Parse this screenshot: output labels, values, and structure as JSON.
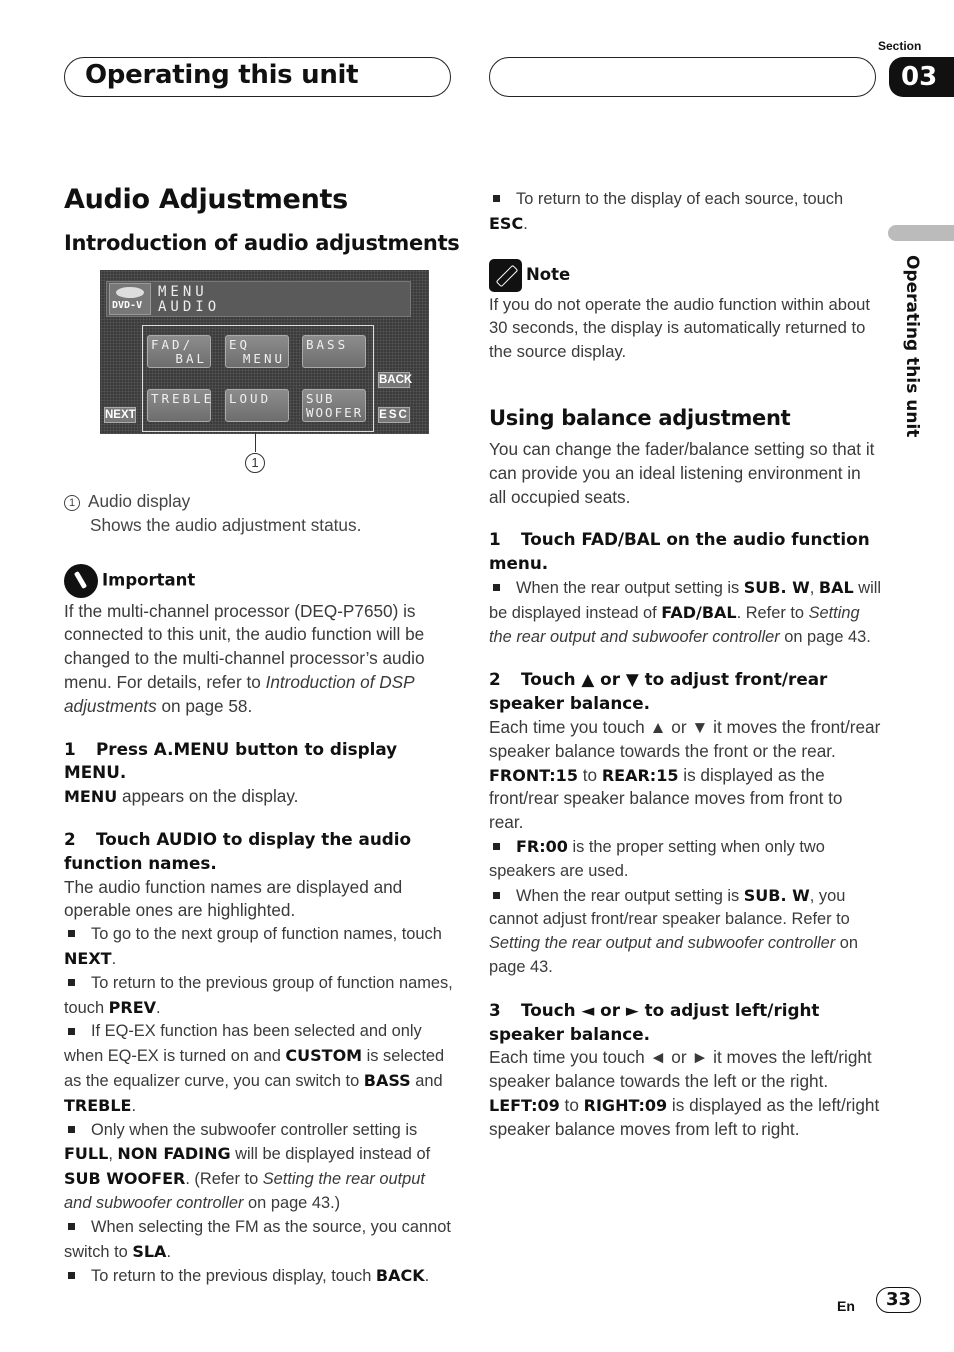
{
  "header": {
    "chapter_title": "Operating this unit",
    "section_label": "Section",
    "section_number": "03",
    "side_tab_text": "Operating this unit"
  },
  "main_title": "Audio Adjustments",
  "left": {
    "intro_heading": "Introduction of audio adjustments",
    "screen": {
      "source_icon_label": "DVD-V",
      "line1": "MENU",
      "line2": "AUDIO",
      "function_buttons": [
        {
          "l1": "FAD/",
          "l2": "BAL"
        },
        {
          "l1": "EQ",
          "l2": "MENU"
        },
        {
          "l1": "BASS",
          "l2": ""
        },
        {
          "l1": "TREBLE",
          "l2": ""
        },
        {
          "l1": "LOUD",
          "l2": ""
        },
        {
          "l1": "SUB",
          "l2": "WOOFER"
        }
      ],
      "next_label": "NEXT",
      "back_label": "BACK",
      "esc_label": "ESC",
      "callout_number": "1"
    },
    "legend_number": "1",
    "legend_title": "Audio display",
    "legend_desc": "Shows the audio adjustment status.",
    "important_title": "Important",
    "important_text_1": "If the multi-channel processor (DEQ-P7650) is connected to this unit, the audio function will be changed to the multi-channel processor’s audio menu. For details, refer to ",
    "important_text_ref": "Introduction of DSP adjustments",
    "important_text_2": " on page 58.",
    "step1_num": "1",
    "step1_title": "Press A.MENU button to display MENU.",
    "step1_bold": "MENU",
    "step1_text": " appears on the display.",
    "step2_num": "2",
    "step2_title": "Touch AUDIO to display the audio function names.",
    "step2_text": "The audio function names are displayed and operable ones are highlighted.",
    "bullets": [
      {
        "a": "To go to the next group of function names, touch ",
        "b": "NEXT",
        "c": "."
      },
      {
        "a": "To return to the previous group of function names, touch ",
        "b": "PREV",
        "c": "."
      },
      {
        "a": "If EQ-EX function has been selected and only when EQ-EX is turned on and ",
        "b": "CUSTOM",
        "c": " is selected as the equalizer curve, you can switch to ",
        "d": "BASS",
        "e": " and ",
        "f": "TREBLE",
        "g": "."
      },
      {
        "a": "Only when the subwoofer controller setting is ",
        "b": "FULL",
        "c": ", ",
        "d": "NON FADING",
        "e": " will be displayed instead of ",
        "f": "SUB WOOFER",
        "g": ". (Refer to ",
        "h": "Setting the rear output and subwoofer controller",
        "i": " on page 43.)"
      },
      {
        "a": "When selecting the FM as the source, you cannot switch to ",
        "b": "SLA",
        "c": "."
      },
      {
        "a": "To return to the previous display, touch ",
        "b": "BACK",
        "c": "."
      }
    ]
  },
  "right": {
    "esc_bullet_a": "To return to the display of each source, touch ",
    "esc_bullet_b": "ESC",
    "esc_bullet_c": ".",
    "note_title": "Note",
    "note_text": "If you do not operate the audio function within about 30 seconds, the display is automatically returned to the source display.",
    "balance_heading": "Using balance adjustment",
    "balance_intro": "You can change the fader/balance setting so that it can provide you an ideal listening environment in all occupied seats.",
    "step1_num": "1",
    "step1_title": "Touch FAD/BAL on the audio function menu.",
    "step1_bullet": {
      "a": "When the rear output setting is ",
      "b": "SUB. W",
      "c": ", ",
      "d": "BAL",
      "e": " will be displayed instead of ",
      "f": "FAD/BAL",
      "g": ". Refer to ",
      "h": "Setting the rear output and subwoofer controller",
      "i": " on page 43."
    },
    "step2_num": "2",
    "step2_title": "Touch ▲ or ▼ to adjust front/rear speaker balance.",
    "step2_text": "Each time you touch ▲ or ▼ it moves the front/rear speaker balance towards the front or the rear.",
    "step2_range": {
      "a": "FRONT:15",
      "b": " to ",
      "c": "REAR:15",
      "d": " is displayed as the front/rear speaker balance moves from front to rear."
    },
    "step2_bullet1": {
      "a": "FR:00",
      "b": " is the proper setting when only two speakers are used."
    },
    "step2_bullet2": {
      "a": "When the rear output setting is ",
      "b": "SUB. W",
      "c": ", you cannot adjust front/rear speaker balance. Refer to ",
      "d": "Setting the rear output and subwoofer controller",
      "e": " on page 43."
    },
    "step3_num": "3",
    "step3_title": "Touch ◄ or ► to adjust left/right speaker balance.",
    "step3_text": "Each time you touch ◄ or ► it moves the left/right speaker balance towards the left or the right.",
    "step3_range": {
      "a": "LEFT:09",
      "b": " to ",
      "c": "RIGHT:09",
      "d": " is displayed as the left/right speaker balance moves from left to right."
    }
  },
  "footer": {
    "language": "En",
    "page_number": "33"
  }
}
